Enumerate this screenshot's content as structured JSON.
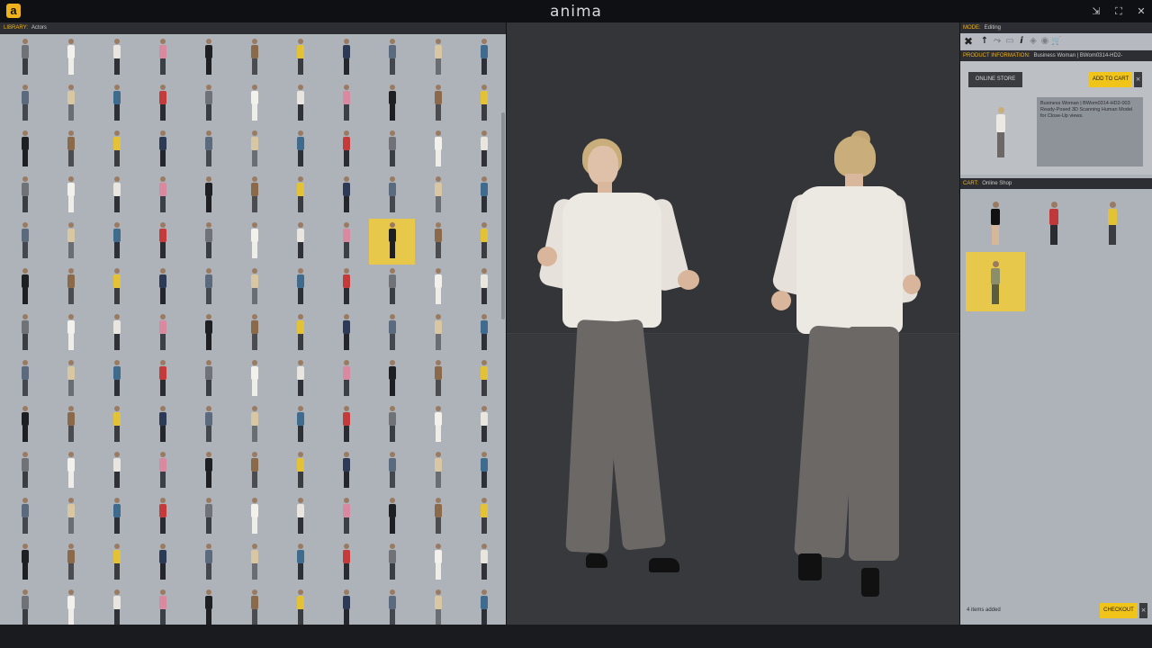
{
  "app": {
    "logo_letter": "a",
    "brand": "anima",
    "window_controls": [
      {
        "name": "restore-icon",
        "glyph": "⇲"
      },
      {
        "name": "fullscreen-icon",
        "glyph": "⛶"
      },
      {
        "name": "close-icon",
        "glyph": "✕"
      }
    ]
  },
  "library": {
    "label": "LIBRARY:",
    "value": "Actors",
    "columns": 11,
    "rows": 13,
    "selected_index": 52,
    "palette": [
      {
        "top": "#6f7378",
        "legs": "#3a3d42"
      },
      {
        "top": "#2d3a55",
        "legs": "#24262b"
      },
      {
        "top": "#e9e6e0",
        "legs": "#2f3136"
      },
      {
        "top": "#d9c7a3",
        "legs": "#6a6e73"
      },
      {
        "top": "#1e1f23",
        "legs": "#1e1f23"
      },
      {
        "top": "#c53a3a",
        "legs": "#2a2c31"
      },
      {
        "top": "#e4c235",
        "legs": "#3a3c40"
      },
      {
        "top": "#f3f1ec",
        "legs": "#efede8"
      },
      {
        "top": "#5c6a7d",
        "legs": "#44484e"
      },
      {
        "top": "#d98aa0",
        "legs": "#3b3f46"
      },
      {
        "top": "#3f6b8f",
        "legs": "#2d3036"
      },
      {
        "top": "#8a6a4a",
        "legs": "#4a4c50"
      }
    ]
  },
  "toolbar": {
    "mode_label": "MODE:",
    "mode_value": "Editing",
    "tools": [
      {
        "name": "tools-icon",
        "glyph": "✖",
        "dim": false
      },
      {
        "name": "upload-icon",
        "glyph": "↑",
        "dim": false
      },
      {
        "name": "route-icon",
        "glyph": "⤳",
        "dim": true
      },
      {
        "name": "frames-icon",
        "glyph": "▭",
        "dim": true
      },
      {
        "name": "info-icon",
        "glyph": "i",
        "dim": false
      },
      {
        "name": "layers-icon",
        "glyph": "◈",
        "dim": true
      },
      {
        "name": "camera-icon",
        "glyph": "◉",
        "dim": true
      },
      {
        "name": "cart-icon",
        "glyph": "🛒",
        "dim": false
      }
    ]
  },
  "product": {
    "header_label": "PRODUCT INFORMATION:",
    "header_value": "Business Woman | BWom0314-HD2-",
    "online_store_label": "ONLINE STORE",
    "add_to_cart_label": "ADD TO CART",
    "close_glyph": "×",
    "description": "Business Woman | BWom0314-HD2-003 Ready-Posed 3D Scanning Human Model for Close-Up views."
  },
  "cart": {
    "label": "CART:",
    "value": "Online Shop",
    "items_added": "4 items added",
    "checkout_label": "CHECKOUT",
    "close_glyph": "×",
    "items": [
      {
        "top": "#111111",
        "legs": "#d7b79b",
        "selected": false
      },
      {
        "top": "#c0393a",
        "legs": "#2a2c31",
        "selected": false
      },
      {
        "top": "#e4c235",
        "legs": "#3a3c40",
        "selected": false
      },
      {
        "top": "#8a8f6a",
        "legs": "#5a5c40",
        "selected": true
      }
    ]
  }
}
